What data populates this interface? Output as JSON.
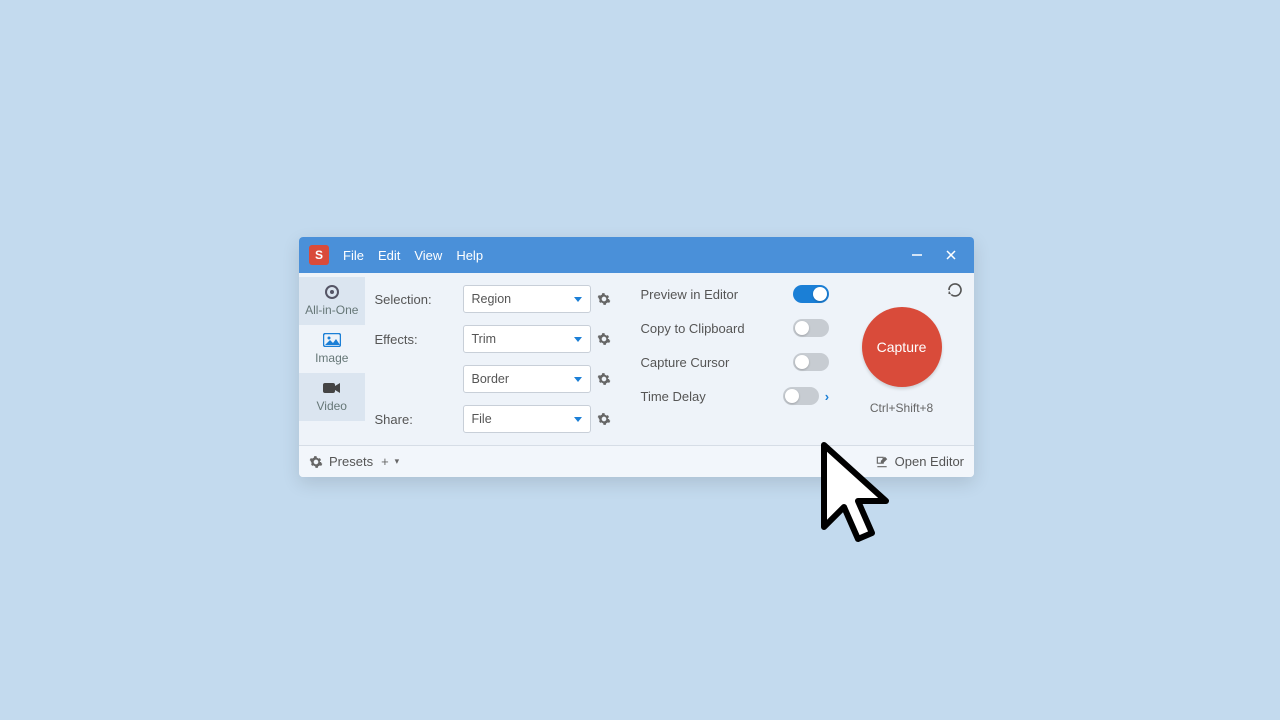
{
  "app_icon_letter": "S",
  "menu": {
    "file": "File",
    "edit": "Edit",
    "view": "View",
    "help": "Help"
  },
  "tabs": {
    "all": "All-in-One",
    "image": "Image",
    "video": "Video"
  },
  "labels": {
    "selection": "Selection:",
    "effects": "Effects:",
    "share": "Share:"
  },
  "dropdown": {
    "selection": "Region",
    "effect1": "Trim",
    "effect2": "Border",
    "share": "File"
  },
  "options": {
    "preview": "Preview in Editor",
    "clipboard": "Copy to Clipboard",
    "cursor": "Capture Cursor",
    "delay": "Time Delay"
  },
  "capture": {
    "label": "Capture",
    "shortcut": "Ctrl+Shift+8"
  },
  "footer": {
    "presets": "Presets",
    "open_editor": "Open Editor"
  }
}
